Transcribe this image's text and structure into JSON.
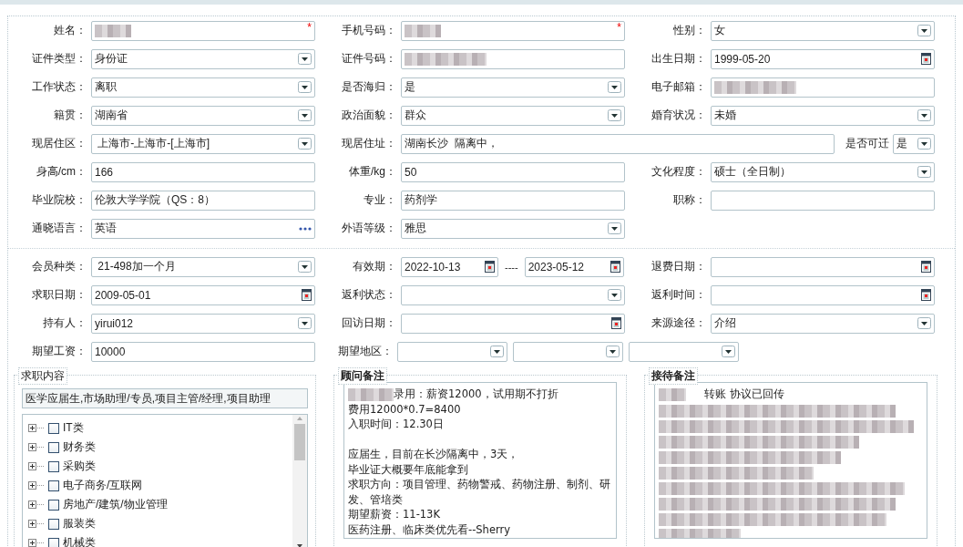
{
  "profile": {
    "rows": [
      [
        {
          "kind": "text",
          "label": "姓名：",
          "blurred": true,
          "required_mark": "*"
        },
        {
          "kind": "text",
          "label": "手机号码：",
          "blurred": true,
          "required_mark": "*"
        },
        {
          "kind": "select",
          "label": "性别：",
          "value": "女"
        }
      ],
      [
        {
          "kind": "select",
          "label": "证件类型：",
          "value": "身份证"
        },
        {
          "kind": "text",
          "label": "证件号码：",
          "blurred": true
        },
        {
          "kind": "date",
          "label": "出生日期：",
          "value": "1999-05-20"
        }
      ],
      [
        {
          "kind": "select",
          "label": "工作状态：",
          "value": "离职"
        },
        {
          "kind": "select",
          "label": "是否海归：",
          "value": "是"
        },
        {
          "kind": "text",
          "label": "电子邮箱：",
          "blurred": true
        }
      ],
      [
        {
          "kind": "select",
          "label": "籍贯：",
          "value": "湖南省"
        },
        {
          "kind": "select",
          "label": "政治面貌：",
          "value": "群众"
        },
        {
          "kind": "select",
          "label": "婚育状况：",
          "value": "未婚"
        }
      ],
      [
        {
          "kind": "select",
          "label": "现居住区：",
          "value": " 上海市-上海市-[上海市]"
        },
        {
          "kind": "wide",
          "label": "现居住址：",
          "value": "湖南长沙  隔离中，",
          "extra_label": "是否可迁",
          "extra_value": "是"
        }
      ],
      [
        {
          "kind": "text",
          "label": "身高/cm：",
          "value": "166"
        },
        {
          "kind": "text",
          "label": "体重/kg：",
          "value": "50"
        },
        {
          "kind": "select",
          "label": "文化程度：",
          "value": "硕士（全日制）"
        }
      ],
      [
        {
          "kind": "text",
          "label": "毕业院校：",
          "value": "伦敦大学学院（QS：8）"
        },
        {
          "kind": "text",
          "label": "专业：",
          "value": "药剂学"
        },
        {
          "kind": "text",
          "label": "职称："
        }
      ],
      [
        {
          "kind": "lookup",
          "label": "通晓语言：",
          "value": "英语"
        },
        {
          "kind": "select",
          "label": "外语等级：",
          "value": "雅思"
        }
      ]
    ]
  },
  "membership": {
    "rows": [
      [
        {
          "kind": "select",
          "label": "会员种类：",
          "value": " 21-498加一个月"
        },
        {
          "kind": "range",
          "label": "有效期：",
          "from": "2022-10-13",
          "separator": "----",
          "to": "2023-05-12"
        },
        {
          "kind": "date",
          "label": "退费日期："
        }
      ],
      [
        {
          "kind": "date",
          "label": "求职日期：",
          "value": "2009-05-01"
        },
        {
          "kind": "select",
          "label": "返利状态："
        },
        {
          "kind": "date",
          "label": "返利时间："
        }
      ],
      [
        {
          "kind": "select",
          "label": "持有人：",
          "value": "yirui012"
        },
        {
          "kind": "date",
          "label": "回访日期："
        },
        {
          "kind": "select",
          "label": "来源途径：",
          "value": "介绍"
        }
      ],
      [
        {
          "kind": "text",
          "label": "期望工资：",
          "value": "10000"
        },
        {
          "kind": "multi",
          "label": "期望地区：",
          "selects": [
            {
              "kind": "select"
            },
            {
              "kind": "select"
            },
            {
              "kind": "select"
            }
          ]
        }
      ]
    ]
  },
  "job_intent": {
    "title": "求职内容",
    "summary": "医学应届生,市场助理/专员,项目主管/经理,项目助理",
    "categories": [
      {
        "label": "IT类",
        "expanded": false,
        "checked": false
      },
      {
        "label": "财务类",
        "expanded": false,
        "checked": false
      },
      {
        "label": "采购类",
        "expanded": false,
        "checked": false
      },
      {
        "label": "电子商务/互联网",
        "expanded": false,
        "checked": false
      },
      {
        "label": "房地产/建筑/物业管理",
        "expanded": false,
        "checked": false
      },
      {
        "label": "服装类",
        "expanded": false,
        "checked": false
      },
      {
        "label": "机械类",
        "expanded": false,
        "checked": false
      }
    ]
  },
  "consultant_notes": {
    "title": "顾问备注",
    "lines": [
      {
        "kind": "text",
        "text": "录用：薪资12000，试用期不打折",
        "blurred_prefix": true
      },
      {
        "kind": "text",
        "text": "费用12000*0.7=8400"
      },
      {
        "kind": "text",
        "text": "入职时间：12.30日"
      },
      {
        "kind": "blank"
      },
      {
        "kind": "text",
        "text": "应届生，目前在长沙隔离中，3天，"
      },
      {
        "kind": "text",
        "text": "毕业证大概要年底能拿到"
      },
      {
        "kind": "text",
        "text": "求职方向：项目管理、药物警戒、药物注册、制剂、研发、管培类"
      },
      {
        "kind": "text",
        "text": "期望薪资：11-13K"
      },
      {
        "kind": "text",
        "text": "医药注册、临床类优先看--Sherry"
      }
    ]
  },
  "reception_notes": {
    "title": "接待备注",
    "visible_text": "转账 协议已回传",
    "blurred": true
  }
}
